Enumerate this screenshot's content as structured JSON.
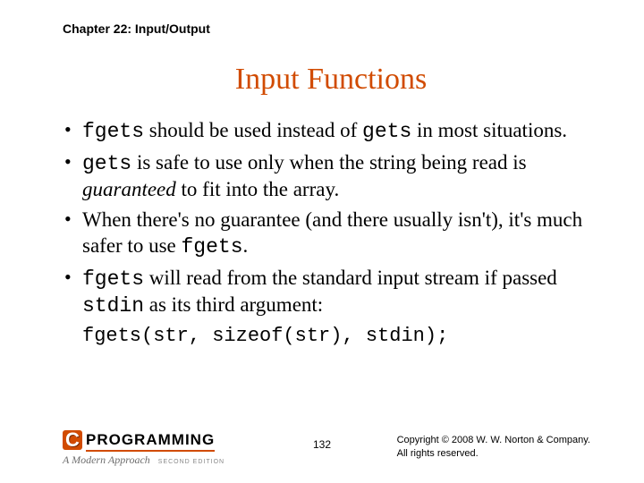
{
  "header": {
    "chapter": "Chapter 22: Input/Output"
  },
  "title": "Input Functions",
  "bullets": [
    {
      "pre": "",
      "code1": "fgets",
      "mid1": " should be used instead of ",
      "code2": "gets",
      "mid2": " in most situations.",
      "post": ""
    },
    {
      "pre": "",
      "code1": "gets",
      "mid1": " is safe to use only when the string being read is ",
      "ital": "guaranteed",
      "mid2": " to fit into the array.",
      "post": ""
    },
    {
      "pre": "When there's no guarantee (and there usually isn't), it's much safer to use ",
      "code1": "fgets",
      "mid1": ".",
      "post": ""
    },
    {
      "pre": "",
      "code1": "fgets",
      "mid1": " will read from the standard input stream if passed ",
      "code2": "stdin",
      "mid2": " as its third argument:",
      "post": ""
    }
  ],
  "codeblock": "fgets(str, sizeof(str), stdin);",
  "footer": {
    "logo_letter": "C",
    "logo_text": "PROGRAMMING",
    "logo_sub": "A Modern Approach",
    "logo_edition": "SECOND EDITION",
    "page": "132",
    "copyright_l1": "Copyright © 2008 W. W. Norton & Company.",
    "copyright_l2": "All rights reserved."
  }
}
